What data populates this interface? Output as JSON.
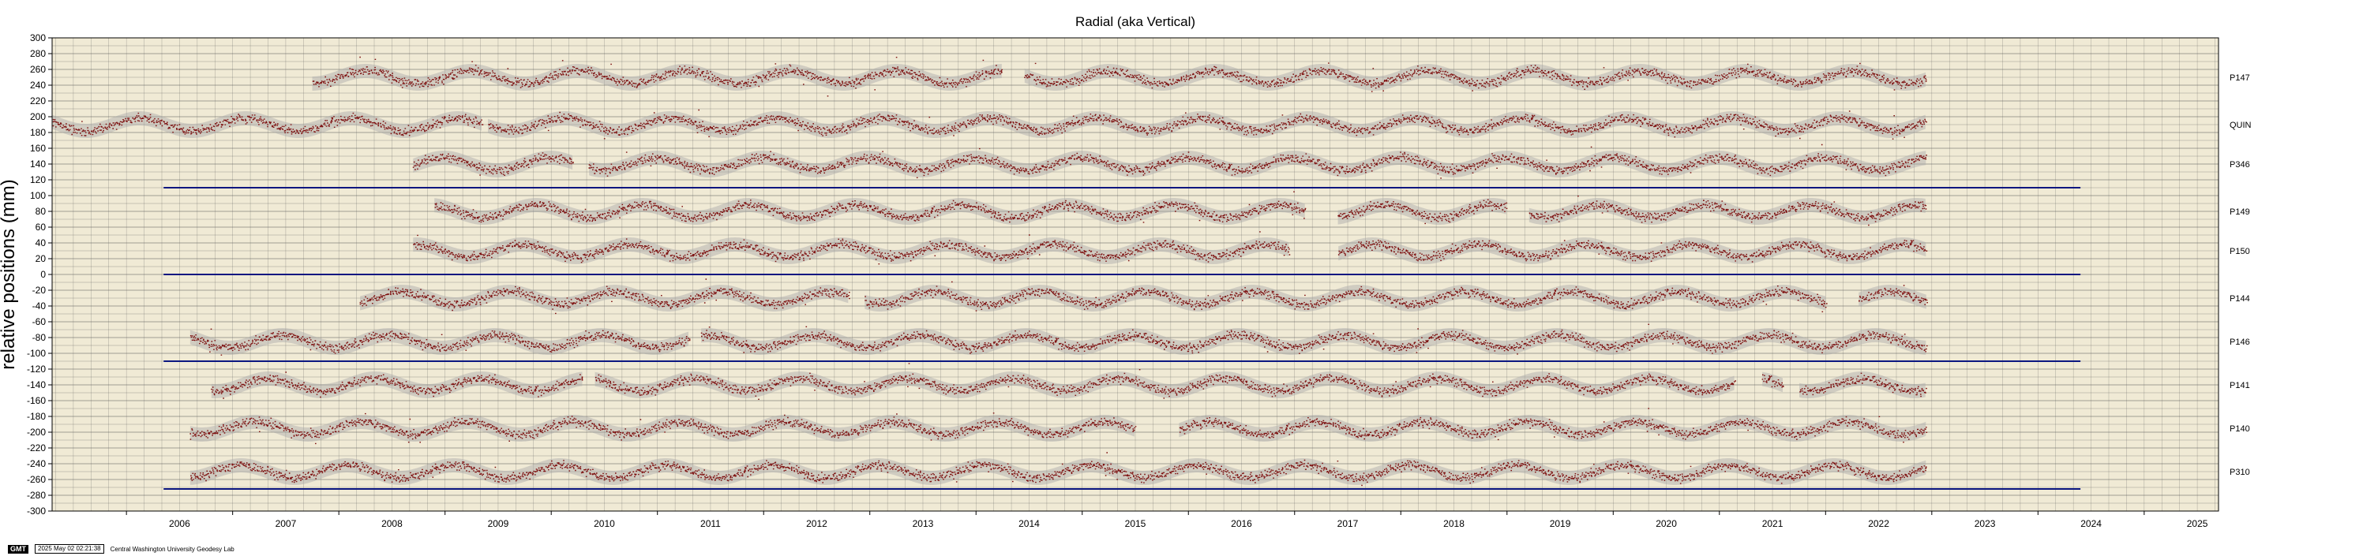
{
  "chart_data": {
    "type": "scatter",
    "title": "Radial (aka Vertical)",
    "ylabel": "relative positions (mm)",
    "xlabel": "",
    "xlim": [
      2005.3,
      2025.7
    ],
    "ylim": [
      -300,
      300
    ],
    "grid": true,
    "y_ticks": [
      "300",
      "280",
      "260",
      "240",
      "220",
      "200",
      "180",
      "160",
      "140",
      "120",
      "100",
      "80",
      "60",
      "40",
      "20",
      "0",
      "-20",
      "-40",
      "-60",
      "-80",
      "-100",
      "-120",
      "-140",
      "-160",
      "-180",
      "-200",
      "-220",
      "-240",
      "-260",
      "-280",
      "-300"
    ],
    "x_ticks": [
      "2006",
      "2007",
      "2008",
      "2009",
      "2010",
      "2011",
      "2012",
      "2013",
      "2014",
      "2015",
      "2016",
      "2017",
      "2018",
      "2019",
      "2020",
      "2021",
      "2022",
      "2023",
      "2024",
      "2025"
    ],
    "series": [
      {
        "name": "P147",
        "offset": 250,
        "start": 2007.75,
        "end": 2022.95,
        "gaps": [
          [
            2014.25,
            2014.45
          ]
        ]
      },
      {
        "name": "QUIN",
        "offset": 190,
        "start": 2005.3,
        "end": 2022.95,
        "gaps": [
          [
            2009.35,
            2009.4
          ]
        ]
      },
      {
        "name": "P346",
        "offset": 140,
        "start": 2008.7,
        "end": 2022.95,
        "gaps": [
          [
            2010.2,
            2010.35
          ]
        ]
      },
      {
        "name": "P149",
        "offset": 80,
        "start": 2008.9,
        "end": 2022.95,
        "gaps": [
          [
            2017.1,
            2017.4
          ],
          [
            2019.0,
            2019.2
          ]
        ]
      },
      {
        "name": "P150",
        "offset": 30,
        "start": 2008.7,
        "end": 2022.95,
        "gaps": [
          [
            2016.95,
            2017.4
          ]
        ]
      },
      {
        "name": "P144",
        "offset": -30,
        "start": 2008.2,
        "end": 2022.95,
        "gaps": [
          [
            2012.8,
            2012.95
          ],
          [
            2022.0,
            2022.3
          ]
        ]
      },
      {
        "name": "P146",
        "offset": -85,
        "start": 2006.6,
        "end": 2022.95,
        "gaps": [
          [
            2011.3,
            2011.4
          ]
        ]
      },
      {
        "name": "P141",
        "offset": -140,
        "start": 2006.8,
        "end": 2022.95,
        "gaps": [
          [
            2010.3,
            2010.4
          ],
          [
            2021.15,
            2021.4
          ],
          [
            2021.6,
            2021.75
          ]
        ]
      },
      {
        "name": "P140",
        "offset": -195,
        "start": 2006.6,
        "end": 2022.95,
        "gaps": [
          [
            2015.5,
            2015.9
          ]
        ]
      },
      {
        "name": "P310",
        "offset": -250,
        "start": 2006.6,
        "end": 2022.95,
        "gaps": []
      }
    ],
    "horizontal_lines": [
      110,
      0,
      -110,
      -272
    ]
  },
  "colors": {
    "plot_background": "#f0ead5",
    "grid": "#5a5a5a",
    "points": "#7d0f0f",
    "envelope": "#a9a9a9",
    "hlines": "#0b1680"
  },
  "footer": {
    "badge": "GMT",
    "timestamp": "2025 May 02 02:21:38",
    "credit": "Central Washington University Geodesy Lab"
  }
}
